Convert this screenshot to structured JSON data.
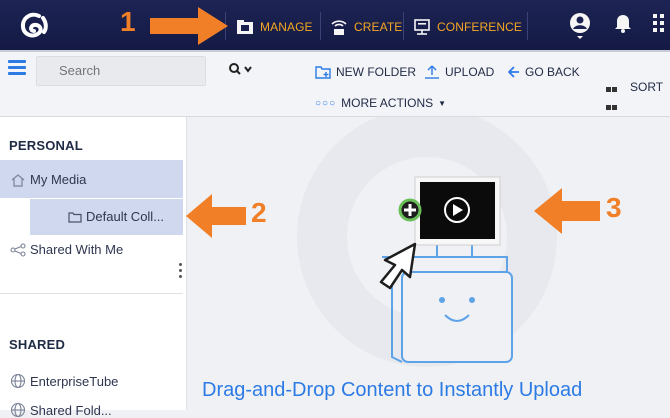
{
  "topbar": {
    "nav": [
      {
        "label": "MANAGE",
        "icon": "film-folder-icon"
      },
      {
        "label": "CREATE",
        "icon": "broadcast-icon"
      },
      {
        "label": "CONFERENCE",
        "icon": "presentation-icon"
      }
    ],
    "right_icons": [
      "user-avatar-icon",
      "bell-icon",
      "app-grid-icon"
    ]
  },
  "toolbar": {
    "search_placeholder": "Search",
    "actions": [
      {
        "label": "NEW FOLDER",
        "icon": "new-folder-icon"
      },
      {
        "label": "UPLOAD",
        "icon": "upload-icon"
      },
      {
        "label": "GO BACK",
        "icon": "back-arrow-icon"
      }
    ],
    "more_actions": "MORE ACTIONS",
    "sort_label": "SORT"
  },
  "sidebar": {
    "personal_title": "PERSONAL",
    "personal_items": [
      {
        "label": "My Media",
        "icon": "home-icon"
      },
      {
        "label": "Default Coll...",
        "icon": "folder-icon"
      },
      {
        "label": "Shared With Me",
        "icon": "share-icon"
      }
    ],
    "shared_title": "SHARED",
    "shared_items": [
      {
        "label": "EnterpriseTube",
        "icon": "globe-icon"
      },
      {
        "label": "Shared Fold...",
        "icon": "globe-icon"
      }
    ]
  },
  "main": {
    "drop_caption": "Drag-and-Drop Content to Instantly Upload"
  },
  "annotations": [
    "1",
    "2",
    "3"
  ],
  "colors": {
    "accent": "#2c7be5",
    "topbar": "#1a2050",
    "nav_text": "#f5a623",
    "annotation": "#f07f27",
    "selected": "#cfd8ee"
  }
}
